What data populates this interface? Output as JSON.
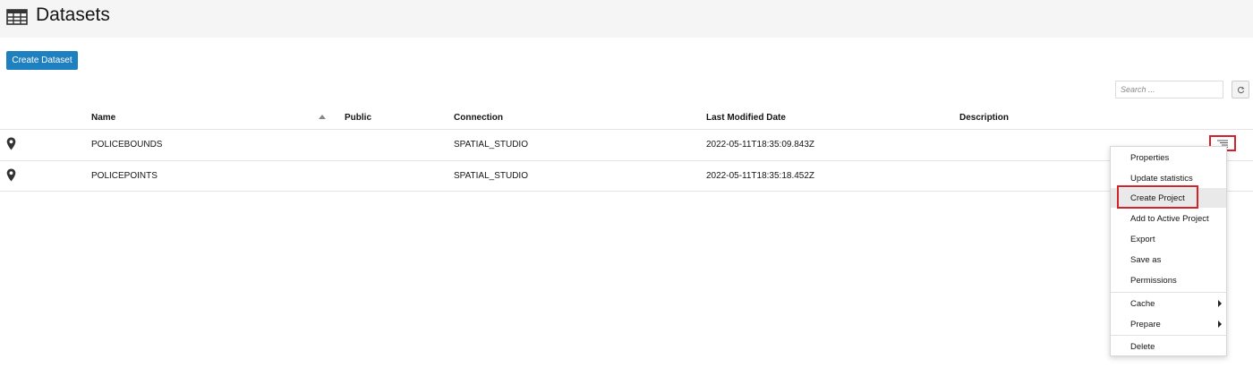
{
  "header": {
    "title": "Datasets",
    "icon": "table-grid-icon"
  },
  "toolbar": {
    "create_label": "Create Dataset"
  },
  "search": {
    "placeholder": "Search ...",
    "value": ""
  },
  "table": {
    "columns": [
      "Name",
      "Public",
      "Connection",
      "Last Modified Date",
      "Description"
    ],
    "sort": {
      "column": "Name",
      "direction": "ascending"
    },
    "rows": [
      {
        "icon": "map-pin-icon",
        "name": "POLICEBOUNDS",
        "public": "",
        "connection": "SPATIAL_STUDIO",
        "modified": "2022-05-11T18:35:09.843Z",
        "description": ""
      },
      {
        "icon": "map-pin-icon",
        "name": "POLICEPOINTS",
        "public": "",
        "connection": "SPATIAL_STUDIO",
        "modified": "2022-05-11T18:35:18.452Z",
        "description": ""
      }
    ]
  },
  "context_menu": {
    "items": [
      {
        "label": "Properties"
      },
      {
        "label": "Update statistics"
      },
      {
        "label": "Create Project",
        "highlighted": true
      },
      {
        "label": "Add to Active Project"
      },
      {
        "label": "Export"
      },
      {
        "label": "Save as"
      },
      {
        "label": "Permissions"
      },
      {
        "label": "Cache",
        "submenu": true
      },
      {
        "label": "Prepare",
        "submenu": true
      },
      {
        "label": "Delete"
      }
    ]
  },
  "colors": {
    "primary_button": "#1f80c0",
    "highlight_box": "#d4222a",
    "header_bg": "#f5f5f5"
  }
}
